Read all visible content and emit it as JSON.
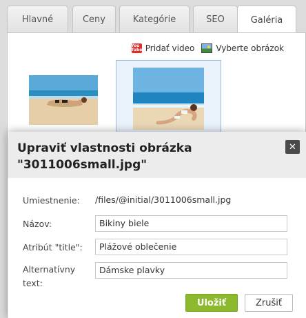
{
  "tabs": [
    {
      "label": "Hlavné",
      "active": false
    },
    {
      "label": "Ceny",
      "active": false
    },
    {
      "label": "Kategórie",
      "active": false
    },
    {
      "label": "SEO",
      "active": false
    },
    {
      "label": "Galéria",
      "active": true
    }
  ],
  "gallery": {
    "add_video_label": "Pridať video",
    "select_images_label": "Vyberte obrázok",
    "video_icon_text": "You Tube"
  },
  "modal": {
    "title_line1": "Upraviť vlastnosti obrázka",
    "title_line2": "\"3011006small.jpg\"",
    "location_label": "Umiestnenie:",
    "location_value": "/files/@initial/3011006small.jpg",
    "name_label": "Názov:",
    "name_value": "Bikiny biele",
    "title_attr_label": "Atribút \"title\":",
    "title_attr_value": "Plážové oblečenie",
    "alt_label_line1": "Alternatívny",
    "alt_label_line2": "text:",
    "alt_value": "Dámske plavky",
    "save_label": "Uložiť",
    "cancel_label": "Zrušiť"
  },
  "colors": {
    "accent_save": "#8db92e",
    "close_button": "#4a4a4a",
    "header_bg": "#ececec"
  }
}
